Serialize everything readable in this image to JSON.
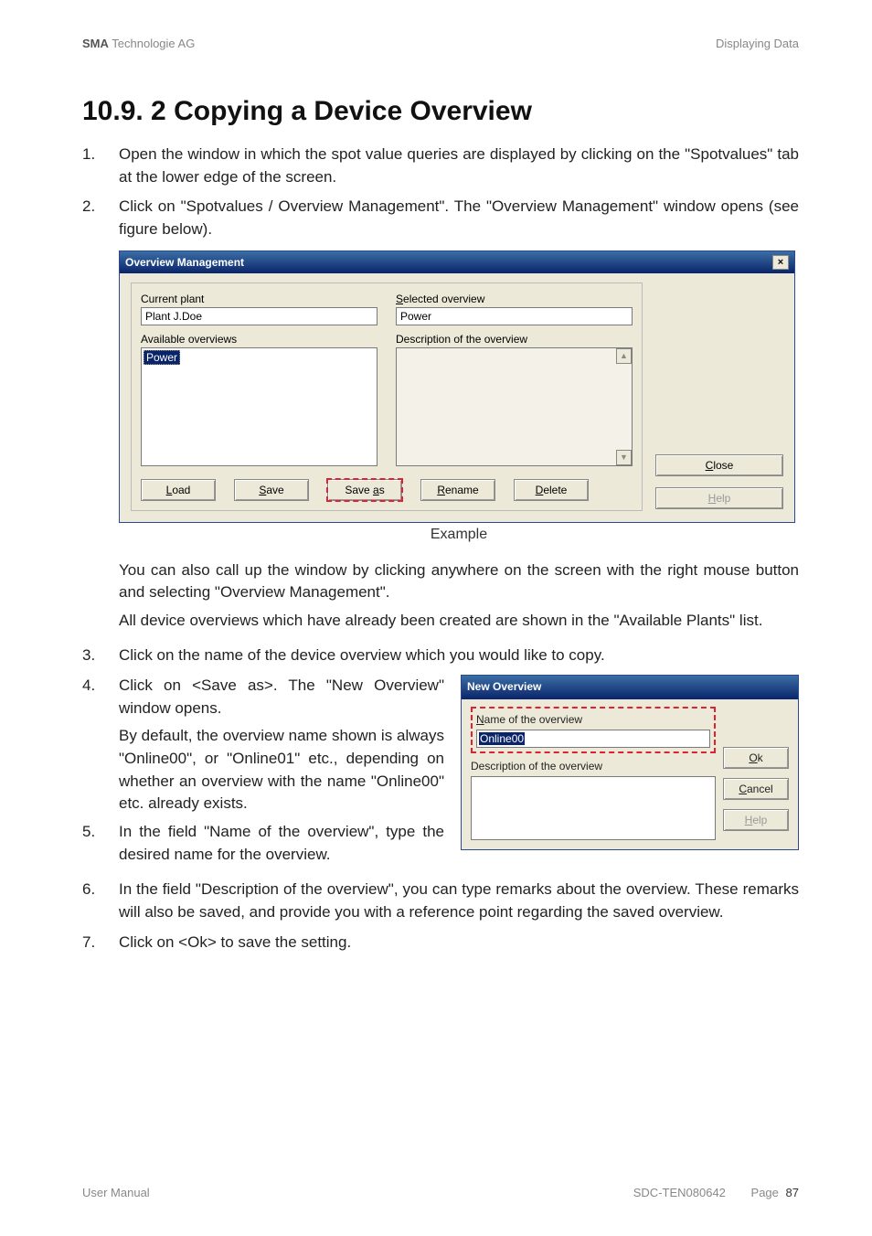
{
  "header": {
    "left_bold": "SMA",
    "left_rest": " Technologie AG",
    "right": "Displaying Data"
  },
  "title": "10.9. 2 Copying a Device Overview",
  "steps": {
    "s1": {
      "num": "1.",
      "text": "Open the window in which the spot value queries are displayed by clicking on the \"Spotvalues\" tab at the lower edge of the screen."
    },
    "s2": {
      "num": "2.",
      "text": "Click on \"Spotvalues / Overview Management\". The \"Overview Management\" window opens (see figure below)."
    },
    "s2b": "You can also call up the window by clicking anywhere on the screen with the right mouse button and selecting \"Overview Management\".",
    "s2c": "All device overviews which have already been created are shown in the \"Available Plants\" list.",
    "s3": {
      "num": "3.",
      "text": "Click on the name of the device overview which you would like to copy."
    },
    "s4": {
      "num": "4.",
      "text": "Click on <Save as>. The \"New Overview\" window opens."
    },
    "s4b": "By default, the overview name shown is always \"Online00\", or \"Online01\" etc., depending on whether an overview with the name \"Online00\" etc. already exists.",
    "s5": {
      "num": "5.",
      "text": "In the field \"Name of the overview\", type the desired name for the overview."
    },
    "s6": {
      "num": "6.",
      "text": "In the field \"Description of the overview\", you can type remarks about the overview. These remarks will also be saved, and provide you with a reference point regarding the saved overview."
    },
    "s7": {
      "num": "7.",
      "text": "Click on <Ok> to save the setting."
    }
  },
  "fig_caption": "Example",
  "win1": {
    "title": "Overview Management",
    "current_plant_label": "Current plant",
    "current_plant_value": "Plant J.Doe",
    "available_label": "Available overviews",
    "available_item": "Power",
    "selected_label_pre": "S",
    "selected_label_rest": "elected overview",
    "selected_value": "Power",
    "desc_label": "Description of the overview",
    "btn_load": "Load",
    "btn_save": "Save",
    "btn_saveas": "Save as",
    "btn_rename": "Rename",
    "btn_delete": "Delete",
    "btn_close": "Close",
    "btn_help": "Help"
  },
  "win2": {
    "title": "New Overview",
    "name_label": "Name of the overview",
    "name_value": "Online00",
    "desc_label": "Description of the overview",
    "btn_ok": "Ok",
    "btn_cancel": "Cancel",
    "btn_help": "Help"
  },
  "footer": {
    "left": "User Manual",
    "mid": "SDC-TEN080642",
    "right_label": "Page",
    "right_num": "87"
  }
}
